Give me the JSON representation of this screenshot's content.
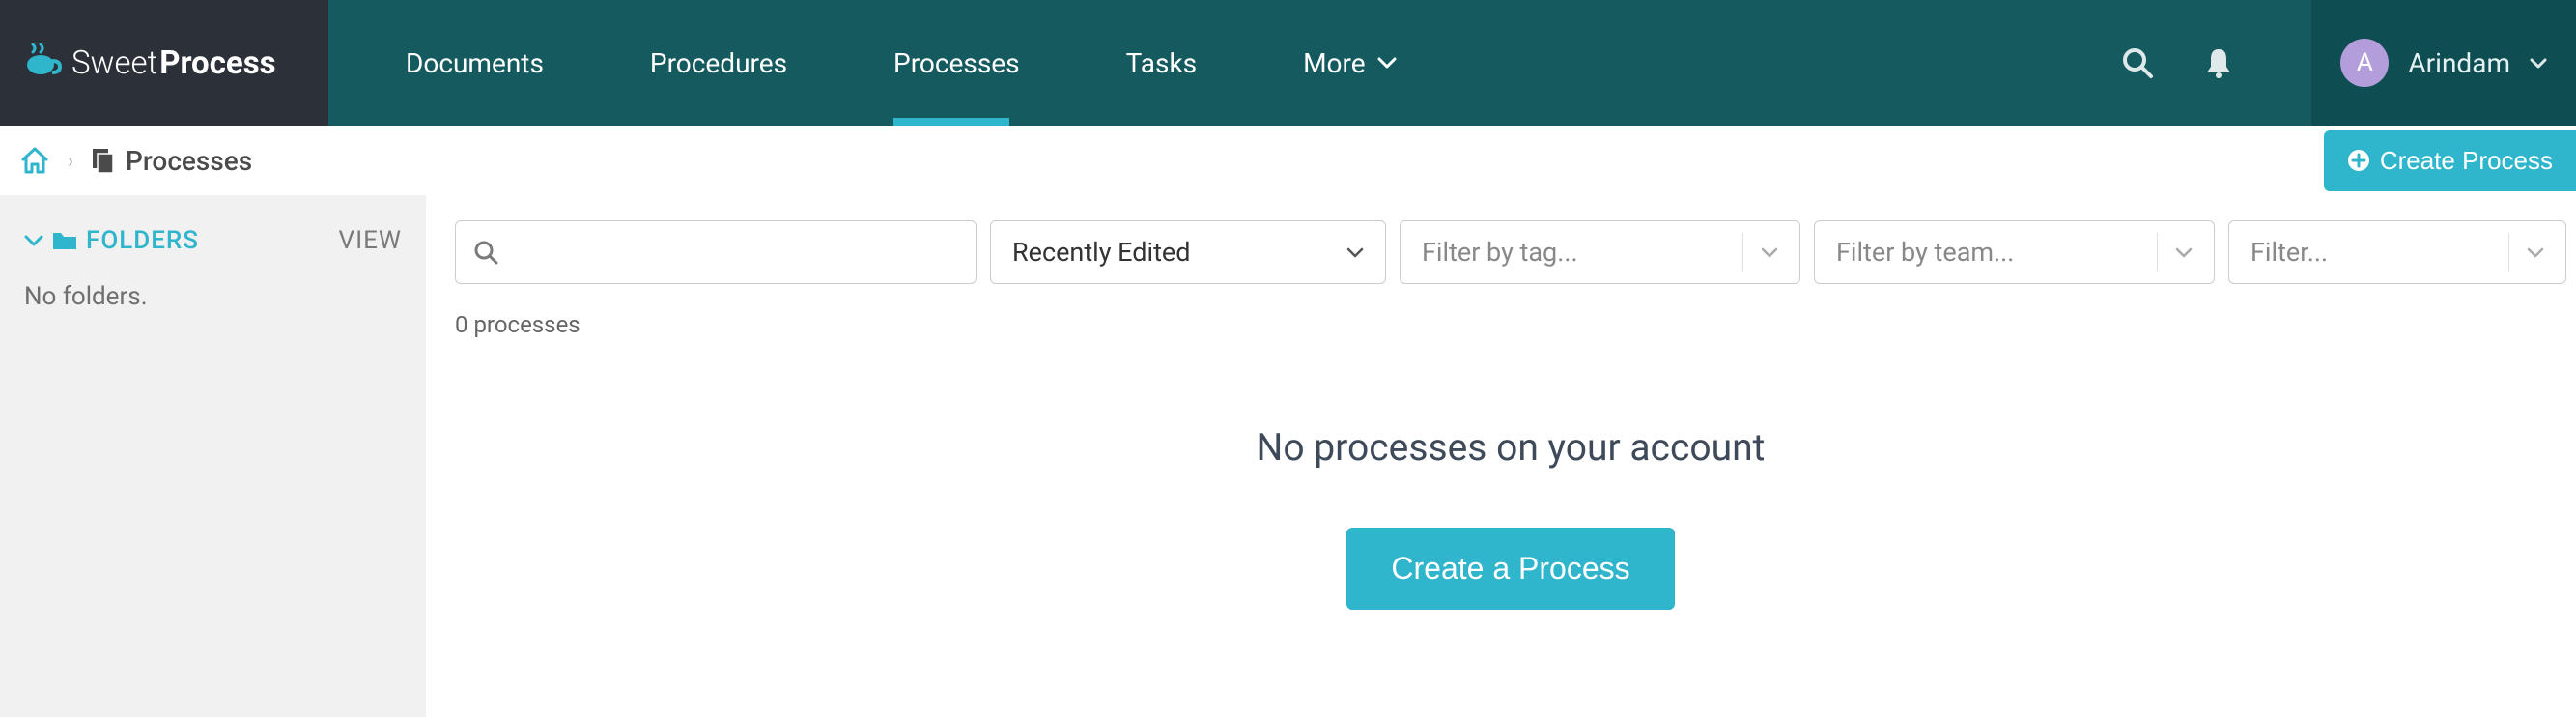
{
  "brand": {
    "sweet": "Sweet",
    "process": "Process"
  },
  "nav": {
    "documents": "Documents",
    "procedures": "Procedures",
    "processes": "Processes",
    "tasks": "Tasks",
    "more": "More"
  },
  "user": {
    "initial": "A",
    "name": "Arindam"
  },
  "breadcrumb": {
    "title": "Processes"
  },
  "actions": {
    "create_process_top": "Create Process",
    "create_process_main": "Create a Process"
  },
  "sidebar": {
    "folders_label": "FOLDERS",
    "view_label": "VIEW",
    "no_folders": "No folders."
  },
  "filters": {
    "sort_selected": "Recently Edited",
    "tag_placeholder": "Filter by tag...",
    "team_placeholder": "Filter by team...",
    "generic_placeholder": "Filter..."
  },
  "main": {
    "count_label": "0 processes",
    "empty_title": "No processes on your account"
  }
}
